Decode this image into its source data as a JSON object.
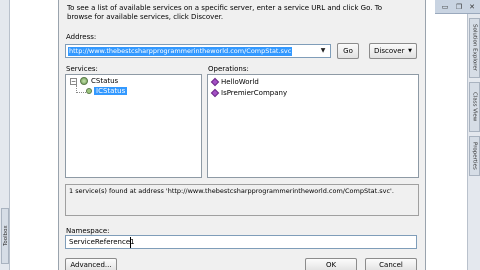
{
  "instructions": "To see a list of available services on a specific server, enter a service URL and click Go. To browse for available services, click Discover.",
  "address": {
    "label": "Address:",
    "value": "http://www.thebestcsharpprogrammerintheworld.com/CompStat.svc"
  },
  "buttons": {
    "go": "Go",
    "discover": "Discover",
    "advanced": "Advanced...",
    "ok": "OK",
    "cancel": "Cancel"
  },
  "services": {
    "label": "Services:",
    "tree": [
      {
        "label": "CStatus",
        "expanded": true
      },
      {
        "label": "ICStatus",
        "selected": true
      }
    ]
  },
  "operations": {
    "label": "Operations:",
    "items": [
      "HelloWorld",
      "IsPremierCompany"
    ]
  },
  "status": "1 service(s) found at address 'http://www.thebestcsharpprogrammerintheworld.com/CompStat.svc'.",
  "namespace": {
    "label": "Namespace:",
    "value": "ServiceReference1"
  },
  "ide": {
    "left_tab": "Toolbox",
    "right_tabs": [
      "Solution Explorer",
      "Class View",
      "Properties"
    ]
  },
  "colors": {
    "selection": "#3399ff",
    "dialog_background": "#f0f0f0",
    "ide_chrome": "#e4e8ee"
  }
}
